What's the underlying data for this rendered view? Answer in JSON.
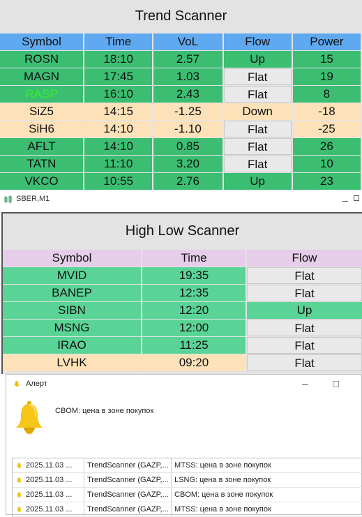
{
  "trend": {
    "title": "Trend Scanner",
    "headers": [
      "Symbol",
      "Time",
      "VoL",
      "Flow",
      "Power"
    ],
    "rows": [
      {
        "symbol": "ROSN",
        "time": "18:10",
        "vol": "2.57",
        "flow": "Up",
        "power": "15",
        "tone": "green",
        "flow_tone": "green"
      },
      {
        "symbol": "MAGN",
        "time": "17:45",
        "vol": "1.03",
        "flow": "Flat",
        "power": "19",
        "tone": "green",
        "flow_tone": "gray"
      },
      {
        "symbol": "RASP",
        "time": "16:10",
        "vol": "2.43",
        "flow": "Flat",
        "power": "8",
        "tone": "green",
        "flow_tone": "gray",
        "highlight": true
      },
      {
        "symbol": "SiZ5",
        "time": "14:15",
        "vol": "-1.25",
        "flow": "Down",
        "power": "-18",
        "tone": "peach",
        "flow_tone": "peach"
      },
      {
        "symbol": "SiH6",
        "time": "14:10",
        "vol": "-1.10",
        "flow": "Flat",
        "power": "-25",
        "tone": "peach",
        "flow_tone": "gray"
      },
      {
        "symbol": "AFLT",
        "time": "14:10",
        "vol": "0.85",
        "flow": "Flat",
        "power": "26",
        "tone": "green",
        "flow_tone": "gray"
      },
      {
        "symbol": "TATN",
        "time": "11:10",
        "vol": "3.20",
        "flow": "Flat",
        "power": "10",
        "tone": "green",
        "flow_tone": "gray"
      },
      {
        "symbol": "VKCO",
        "time": "10:55",
        "vol": "2.76",
        "flow": "Up",
        "power": "23",
        "tone": "green",
        "flow_tone": "green"
      }
    ]
  },
  "chart_window": {
    "name": "SBER,M1",
    "icon": "candlestick-icon"
  },
  "highlow": {
    "title": "High Low Scanner",
    "headers": [
      "Symbol",
      "Time",
      "Flow"
    ],
    "rows": [
      {
        "symbol": "MVID",
        "time": "19:35",
        "flow": "Flat",
        "tone": "lg",
        "flow_tone": "gray"
      },
      {
        "symbol": "BANEP",
        "time": "12:35",
        "flow": "Flat",
        "tone": "lg",
        "flow_tone": "gray"
      },
      {
        "symbol": "SIBN",
        "time": "12:20",
        "flow": "Up",
        "tone": "lg",
        "flow_tone": "lg"
      },
      {
        "symbol": "MSNG",
        "time": "12:00",
        "flow": "Flat",
        "tone": "lg",
        "flow_tone": "gray"
      },
      {
        "symbol": "IRAO",
        "time": "11:25",
        "flow": "Flat",
        "tone": "lg",
        "flow_tone": "gray"
      },
      {
        "symbol": "LVHK",
        "time": "09:20",
        "flow": "Flat",
        "tone": "peach",
        "flow_tone": "gray"
      }
    ]
  },
  "alert": {
    "title": "Алерт",
    "message": "CBOM: цена в зоне покупок",
    "entries": [
      {
        "date": "2025.11.03 ...",
        "source": "TrendScanner (GAZP,...",
        "text": "MTSS: цена в зоне покупок"
      },
      {
        "date": "2025.11.03 ...",
        "source": "TrendScanner (GAZP,...",
        "text": "LSNG: цена в зоне покупок"
      },
      {
        "date": "2025.11.03 ...",
        "source": "TrendScanner (GAZP,...",
        "text": "CBOM: цена в зоне покупок"
      },
      {
        "date": "2025.11.03 ...",
        "source": "TrendScanner (GAZP,...",
        "text": "MTSS: цена в зоне покупок"
      }
    ]
  },
  "colors": {
    "header_blue": "#5fa9f0",
    "green": "#3cbe72",
    "light_green": "#5ad496",
    "peach": "#fde1b8",
    "header_pink": "#e6cde9",
    "bell": "#f2c21b"
  }
}
